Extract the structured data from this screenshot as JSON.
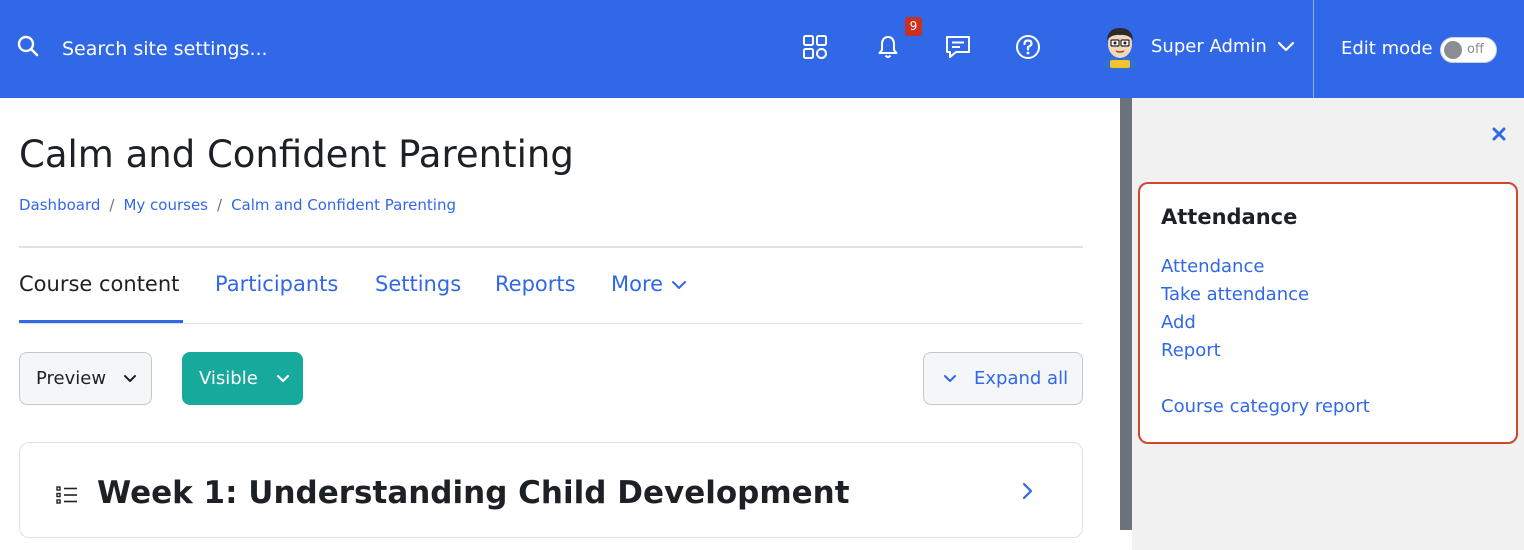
{
  "header": {
    "search": {
      "placeholder": "Search site settings..."
    },
    "notification_count": "9",
    "user_name": "Super Admin",
    "edit_mode_label": "Edit mode",
    "edit_mode_state": "off",
    "icons": [
      "search-icon",
      "apps-grid-icon",
      "bell-icon",
      "message-icon",
      "help-icon",
      "chevron-down-icon"
    ]
  },
  "page": {
    "title": "Calm and Confident Parenting",
    "breadcrumb": [
      "Dashboard",
      "My courses",
      "Calm and Confident Parenting"
    ]
  },
  "tabs": [
    {
      "label": "Course content",
      "active": true
    },
    {
      "label": "Participants",
      "active": false
    },
    {
      "label": "Settings",
      "active": false
    },
    {
      "label": "Reports",
      "active": false
    },
    {
      "label": "More",
      "active": false
    }
  ],
  "toolbar": {
    "preview_label": "Preview",
    "visible_label": "Visible",
    "expand_all_label": "Expand all"
  },
  "section": {
    "title": "Week 1: Understanding Child Development"
  },
  "drawer": {
    "block_title": "Attendance",
    "links": [
      "Attendance",
      "Take attendance",
      "Add",
      "Report",
      "Course category report"
    ]
  },
  "colors": {
    "navbar": "#3168e8",
    "link": "#3168e8",
    "visible_button": "#18a99d",
    "badge": "#ca3120",
    "highlight_border": "#d0462e"
  }
}
